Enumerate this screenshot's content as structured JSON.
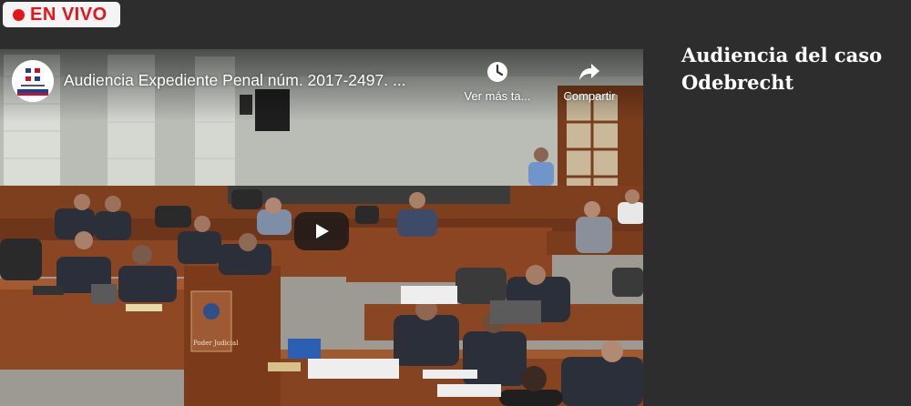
{
  "live_badge": {
    "label": "EN VIVO",
    "color": "#e4141b"
  },
  "player": {
    "channel_logo_icon": "poder-judicial-seal-icon",
    "title": "Audiencia Expediente Penal núm. 2017-2497. ...",
    "watch_later_label": "Ver más ta...",
    "watch_later_icon": "clock-icon",
    "share_label": "Compartir",
    "share_icon": "share-arrow-icon",
    "play_icon": "play-icon",
    "podium_label": "Poder Judicial"
  },
  "sidebar": {
    "title": "Audiencia del caso Odebrecht"
  },
  "colors": {
    "page_background": "#2d2d2d",
    "badge_background": "#f4f4f4",
    "text": "#ffffff"
  }
}
